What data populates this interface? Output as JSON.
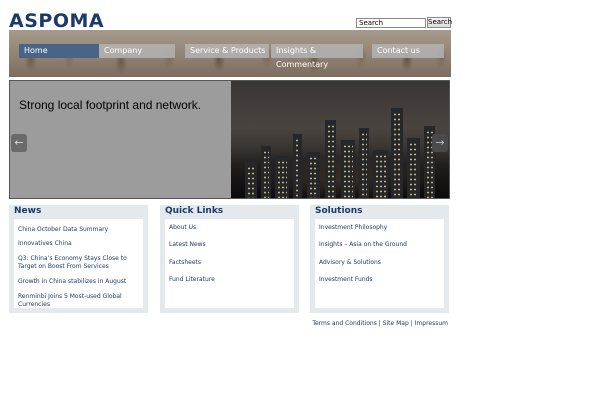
{
  "header": {
    "logo": "ASPOMA",
    "search_placeholder": "Search",
    "search_button": "Search"
  },
  "nav": {
    "items": [
      "Home",
      "Company",
      "Service & Products",
      "Insights & Commentary",
      "Contact us"
    ]
  },
  "slider": {
    "headline": "Strong local footprint and network.",
    "prev_icon": "arrow-left-icon",
    "next_icon": "arrow-right-icon"
  },
  "news": {
    "title": "News",
    "items": [
      "China October Data Summary",
      "Innovatives China",
      "Q3: China’s Economy Stays Close to Target on Boost From Services",
      "Growth in China stabilizes in August",
      "Renminbi Joins 5 Most-used Global Currencies"
    ]
  },
  "quick_links": {
    "title": "Quick Links",
    "items": [
      "About Us",
      "Latest News",
      "Factsheets",
      "Fund Literature"
    ]
  },
  "solutions": {
    "title": "Solutions",
    "items": [
      "Investment Philosophy",
      "Insights – Asia on the Ground",
      "Advisory & Solutions",
      "Investment Funds"
    ]
  },
  "footer": {
    "links": [
      "Terms and Conditions",
      "Site Map",
      "Impressum"
    ],
    "separator": " | "
  },
  "colors": {
    "brand": "#1b3a6b",
    "nav_active": "#4a6487",
    "box_bg": "#e4e9ee"
  }
}
